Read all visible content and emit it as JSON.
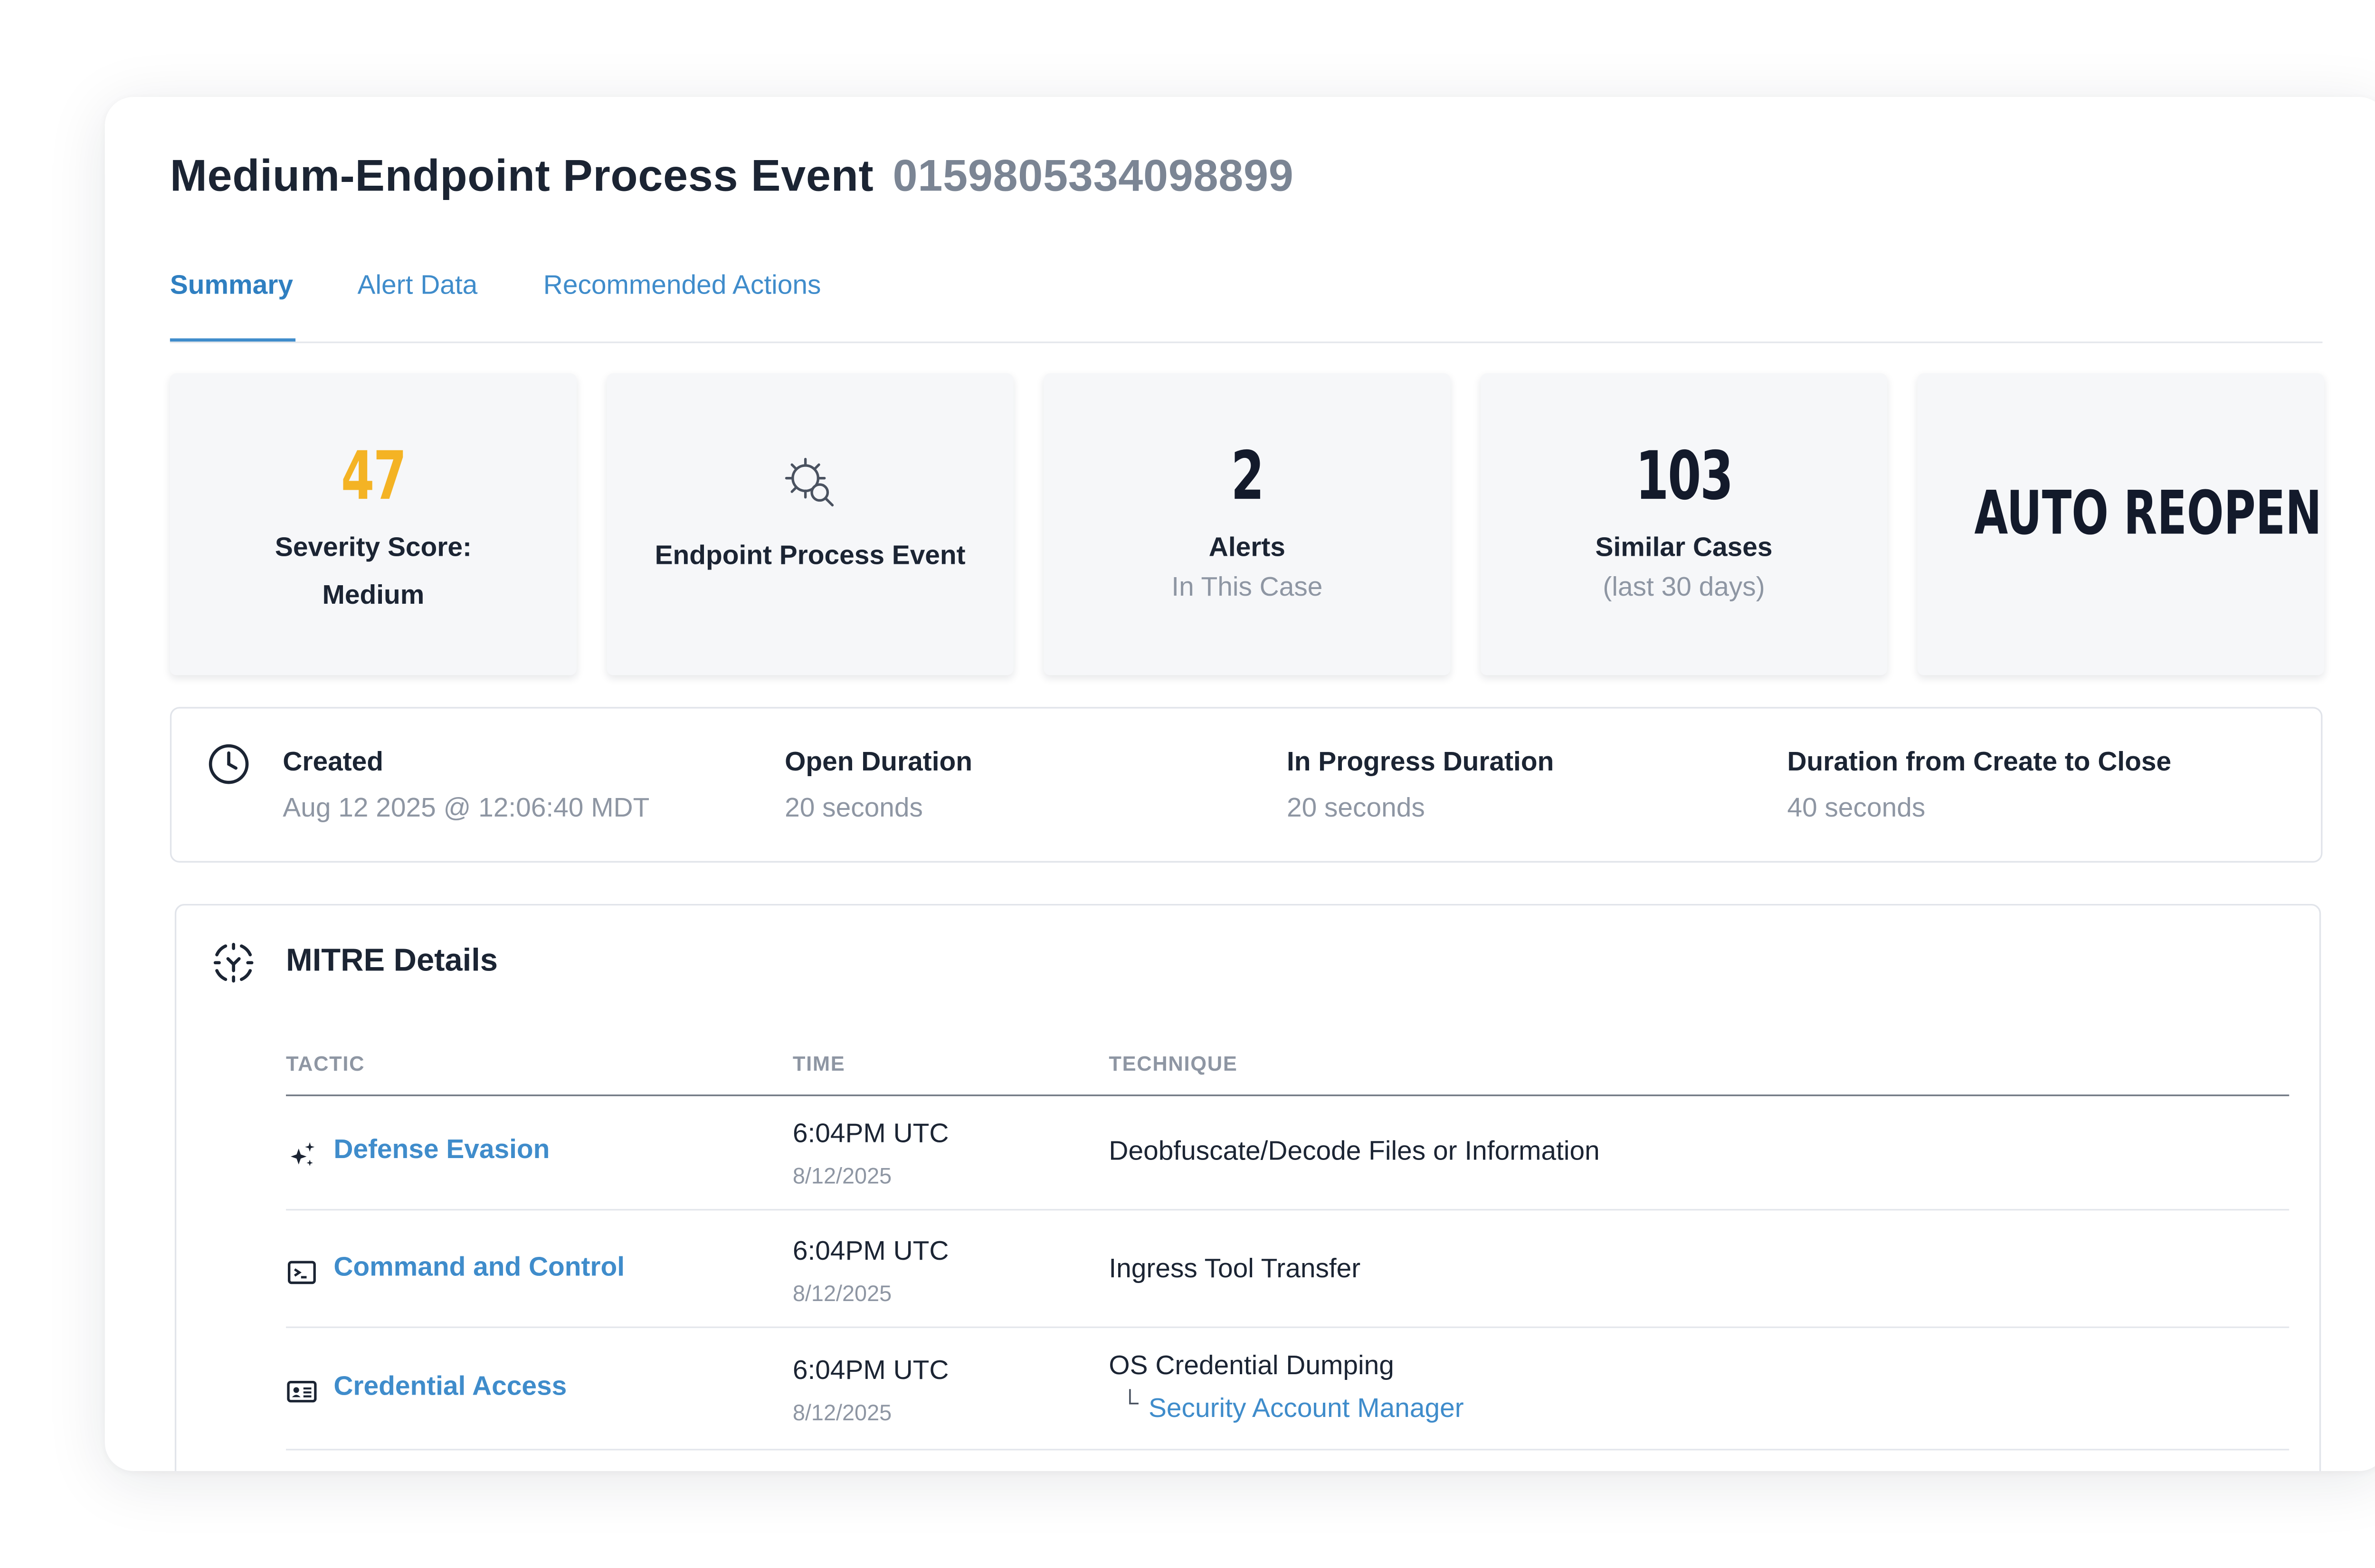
{
  "header": {
    "title": "Medium-Endpoint Process Event",
    "case_id": "0159805334098899"
  },
  "tabs": [
    {
      "label": "Summary",
      "active": true
    },
    {
      "label": "Alert Data",
      "active": false
    },
    {
      "label": "Recommended Actions",
      "active": false
    }
  ],
  "cards": {
    "severity": {
      "value": "47",
      "label": "Severity Score:",
      "sub": "Medium",
      "color": "#f4b324"
    },
    "event_type": {
      "icon": "virus-search-icon",
      "label": "Endpoint Process Event"
    },
    "alerts": {
      "value": "2",
      "label": "Alerts",
      "sub": "In This Case"
    },
    "similar": {
      "value": "103",
      "label": "Similar Cases",
      "sub": "(last 30 days)"
    },
    "status": {
      "value": "AUTO REOPEN"
    }
  },
  "timeline": {
    "icon": "clock-icon",
    "created_label": "Created",
    "created_value": "Aug 12 2025 @ 12:06:40 MDT",
    "open_label": "Open Duration",
    "open_value": "20 seconds",
    "progress_label": "In Progress Duration",
    "progress_value": "20 seconds",
    "close_label": "Duration from Create to Close",
    "close_value": "40 seconds"
  },
  "mitre": {
    "icon": "mitre-target-icon",
    "title": "MITRE Details",
    "columns": [
      "TACTIC",
      "TIME",
      "TECHNIQUE"
    ],
    "rows": [
      {
        "tactic": "Defense Evasion",
        "icon": "sparkles-icon",
        "time": "6:04PM UTC",
        "date": "8/12/2025",
        "technique": "Deobfuscate/Decode Files or Information"
      },
      {
        "tactic": "Command and Control",
        "icon": "terminal-icon",
        "time": "6:04PM UTC",
        "date": "8/12/2025",
        "technique": "Ingress Tool Transfer"
      },
      {
        "tactic": "Credential Access",
        "icon": "id-card-icon",
        "time": "6:04PM UTC",
        "date": "8/12/2025",
        "technique": "OS Credential Dumping",
        "subtechnique": "Security Account Manager"
      }
    ]
  },
  "colors": {
    "accent": "#3f8ccb",
    "severity": "#f4b324",
    "text": "#1b2433",
    "muted": "#8e96a3"
  }
}
